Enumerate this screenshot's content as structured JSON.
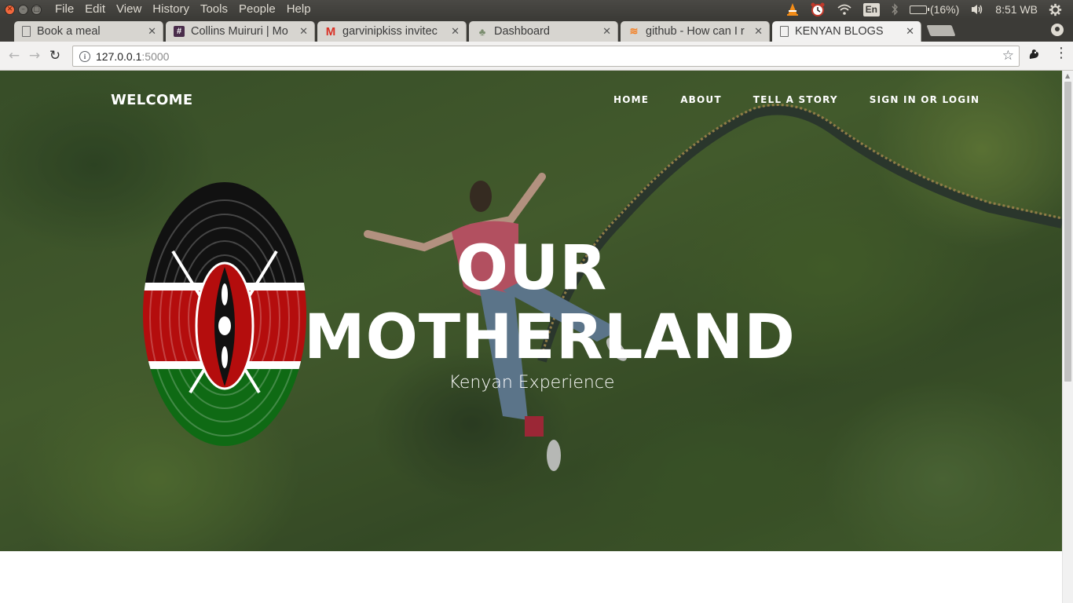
{
  "os_bar": {
    "menu": [
      "File",
      "Edit",
      "View",
      "History",
      "Tools",
      "People",
      "Help"
    ],
    "lang": "En",
    "battery_text": "(16%)",
    "battery_level": 0.16,
    "clock": "8:51 WB"
  },
  "tabs": [
    {
      "title": "Book a meal",
      "icon": "page-icon"
    },
    {
      "title": "Collins Muiruri | Mo",
      "icon": "slack-icon"
    },
    {
      "title": "garvinipkiss invitec",
      "icon": "gmail-icon"
    },
    {
      "title": "Dashboard",
      "icon": "tree-icon"
    },
    {
      "title": "github - How can I r",
      "icon": "stackoverflow-icon"
    },
    {
      "title": "KENYAN BLOGS",
      "icon": "page-icon",
      "active": true
    }
  ],
  "toolbar": {
    "url_host": "127.0.0.1",
    "url_port": ":5000"
  },
  "page": {
    "brand": "WELCOME",
    "nav": [
      "HOME",
      "ABOUT",
      "TELL A STORY",
      "SIGN IN OR LOGIN"
    ],
    "hero_title_line1": "OUR",
    "hero_title_line2": "MOTHERLAND",
    "hero_subtitle": "Kenyan Experience"
  },
  "colors": {
    "kenya_black": "#111111",
    "kenya_red": "#b40d0d",
    "kenya_green": "#0f6a14",
    "kenya_white": "#ffffff"
  }
}
